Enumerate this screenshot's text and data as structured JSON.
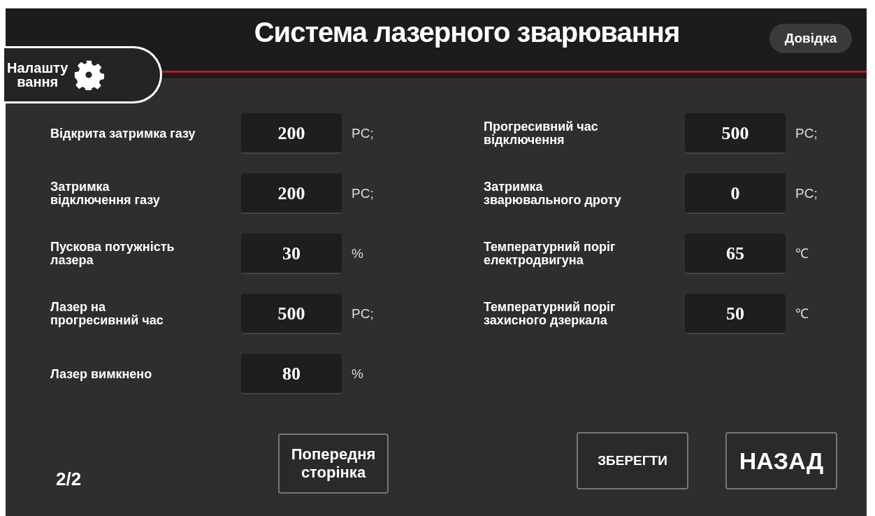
{
  "header": {
    "title": "Система лазерного зварювання",
    "settings_label": "Налашту\nвання",
    "help_button": "Довідка"
  },
  "left_params": [
    {
      "label": "Відкрита затримка газу",
      "value": "200",
      "unit": "PC;"
    },
    {
      "label": "Затримка\nвідключення газу",
      "value": "200",
      "unit": "PC;"
    },
    {
      "label": "Пускова потужність\nлазера",
      "value": "30",
      "unit": "%"
    },
    {
      "label": "Лазер на\nпрогресивний час",
      "value": "500",
      "unit": "PC;"
    },
    {
      "label": "Лазер вимкнено",
      "value": "80",
      "unit": "%"
    }
  ],
  "right_params": [
    {
      "label": "Прогресивний час\nвідключення",
      "value": "500",
      "unit": "PC;"
    },
    {
      "label": "Затримка\nзварювального дроту",
      "value": "0",
      "unit": "PC;"
    },
    {
      "label": "Температурний поріг\nелектродвигуна",
      "value": "65",
      "unit": "℃"
    },
    {
      "label": "Температурний поріг\nзахисного дзеркала",
      "value": "50",
      "unit": "℃"
    }
  ],
  "footer": {
    "page": "2/2",
    "prev_button": "Попередня\nсторінка",
    "save_button": "ЗБЕРЕГТИ",
    "back_button": "НАЗАД"
  }
}
